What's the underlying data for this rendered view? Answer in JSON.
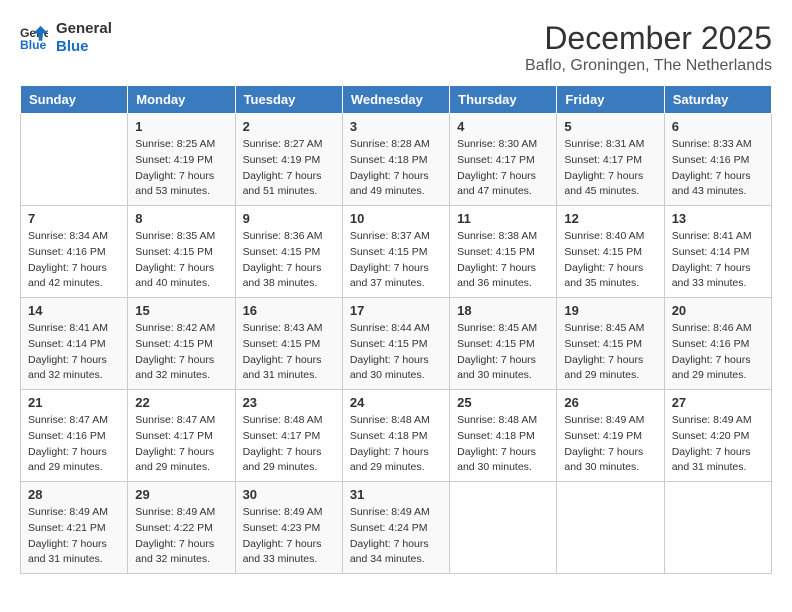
{
  "header": {
    "logo_line1": "General",
    "logo_line2": "Blue",
    "month": "December 2025",
    "location": "Baflo, Groningen, The Netherlands"
  },
  "days_of_week": [
    "Sunday",
    "Monday",
    "Tuesday",
    "Wednesday",
    "Thursday",
    "Friday",
    "Saturday"
  ],
  "weeks": [
    [
      {
        "day": "",
        "sunrise": "",
        "sunset": "",
        "daylight": ""
      },
      {
        "day": "1",
        "sunrise": "Sunrise: 8:25 AM",
        "sunset": "Sunset: 4:19 PM",
        "daylight": "Daylight: 7 hours and 53 minutes."
      },
      {
        "day": "2",
        "sunrise": "Sunrise: 8:27 AM",
        "sunset": "Sunset: 4:19 PM",
        "daylight": "Daylight: 7 hours and 51 minutes."
      },
      {
        "day": "3",
        "sunrise": "Sunrise: 8:28 AM",
        "sunset": "Sunset: 4:18 PM",
        "daylight": "Daylight: 7 hours and 49 minutes."
      },
      {
        "day": "4",
        "sunrise": "Sunrise: 8:30 AM",
        "sunset": "Sunset: 4:17 PM",
        "daylight": "Daylight: 7 hours and 47 minutes."
      },
      {
        "day": "5",
        "sunrise": "Sunrise: 8:31 AM",
        "sunset": "Sunset: 4:17 PM",
        "daylight": "Daylight: 7 hours and 45 minutes."
      },
      {
        "day": "6",
        "sunrise": "Sunrise: 8:33 AM",
        "sunset": "Sunset: 4:16 PM",
        "daylight": "Daylight: 7 hours and 43 minutes."
      }
    ],
    [
      {
        "day": "7",
        "sunrise": "Sunrise: 8:34 AM",
        "sunset": "Sunset: 4:16 PM",
        "daylight": "Daylight: 7 hours and 42 minutes."
      },
      {
        "day": "8",
        "sunrise": "Sunrise: 8:35 AM",
        "sunset": "Sunset: 4:15 PM",
        "daylight": "Daylight: 7 hours and 40 minutes."
      },
      {
        "day": "9",
        "sunrise": "Sunrise: 8:36 AM",
        "sunset": "Sunset: 4:15 PM",
        "daylight": "Daylight: 7 hours and 38 minutes."
      },
      {
        "day": "10",
        "sunrise": "Sunrise: 8:37 AM",
        "sunset": "Sunset: 4:15 PM",
        "daylight": "Daylight: 7 hours and 37 minutes."
      },
      {
        "day": "11",
        "sunrise": "Sunrise: 8:38 AM",
        "sunset": "Sunset: 4:15 PM",
        "daylight": "Daylight: 7 hours and 36 minutes."
      },
      {
        "day": "12",
        "sunrise": "Sunrise: 8:40 AM",
        "sunset": "Sunset: 4:15 PM",
        "daylight": "Daylight: 7 hours and 35 minutes."
      },
      {
        "day": "13",
        "sunrise": "Sunrise: 8:41 AM",
        "sunset": "Sunset: 4:14 PM",
        "daylight": "Daylight: 7 hours and 33 minutes."
      }
    ],
    [
      {
        "day": "14",
        "sunrise": "Sunrise: 8:41 AM",
        "sunset": "Sunset: 4:14 PM",
        "daylight": "Daylight: 7 hours and 32 minutes."
      },
      {
        "day": "15",
        "sunrise": "Sunrise: 8:42 AM",
        "sunset": "Sunset: 4:15 PM",
        "daylight": "Daylight: 7 hours and 32 minutes."
      },
      {
        "day": "16",
        "sunrise": "Sunrise: 8:43 AM",
        "sunset": "Sunset: 4:15 PM",
        "daylight": "Daylight: 7 hours and 31 minutes."
      },
      {
        "day": "17",
        "sunrise": "Sunrise: 8:44 AM",
        "sunset": "Sunset: 4:15 PM",
        "daylight": "Daylight: 7 hours and 30 minutes."
      },
      {
        "day": "18",
        "sunrise": "Sunrise: 8:45 AM",
        "sunset": "Sunset: 4:15 PM",
        "daylight": "Daylight: 7 hours and 30 minutes."
      },
      {
        "day": "19",
        "sunrise": "Sunrise: 8:45 AM",
        "sunset": "Sunset: 4:15 PM",
        "daylight": "Daylight: 7 hours and 29 minutes."
      },
      {
        "day": "20",
        "sunrise": "Sunrise: 8:46 AM",
        "sunset": "Sunset: 4:16 PM",
        "daylight": "Daylight: 7 hours and 29 minutes."
      }
    ],
    [
      {
        "day": "21",
        "sunrise": "Sunrise: 8:47 AM",
        "sunset": "Sunset: 4:16 PM",
        "daylight": "Daylight: 7 hours and 29 minutes."
      },
      {
        "day": "22",
        "sunrise": "Sunrise: 8:47 AM",
        "sunset": "Sunset: 4:17 PM",
        "daylight": "Daylight: 7 hours and 29 minutes."
      },
      {
        "day": "23",
        "sunrise": "Sunrise: 8:48 AM",
        "sunset": "Sunset: 4:17 PM",
        "daylight": "Daylight: 7 hours and 29 minutes."
      },
      {
        "day": "24",
        "sunrise": "Sunrise: 8:48 AM",
        "sunset": "Sunset: 4:18 PM",
        "daylight": "Daylight: 7 hours and 29 minutes."
      },
      {
        "day": "25",
        "sunrise": "Sunrise: 8:48 AM",
        "sunset": "Sunset: 4:18 PM",
        "daylight": "Daylight: 7 hours and 30 minutes."
      },
      {
        "day": "26",
        "sunrise": "Sunrise: 8:49 AM",
        "sunset": "Sunset: 4:19 PM",
        "daylight": "Daylight: 7 hours and 30 minutes."
      },
      {
        "day": "27",
        "sunrise": "Sunrise: 8:49 AM",
        "sunset": "Sunset: 4:20 PM",
        "daylight": "Daylight: 7 hours and 31 minutes."
      }
    ],
    [
      {
        "day": "28",
        "sunrise": "Sunrise: 8:49 AM",
        "sunset": "Sunset: 4:21 PM",
        "daylight": "Daylight: 7 hours and 31 minutes."
      },
      {
        "day": "29",
        "sunrise": "Sunrise: 8:49 AM",
        "sunset": "Sunset: 4:22 PM",
        "daylight": "Daylight: 7 hours and 32 minutes."
      },
      {
        "day": "30",
        "sunrise": "Sunrise: 8:49 AM",
        "sunset": "Sunset: 4:23 PM",
        "daylight": "Daylight: 7 hours and 33 minutes."
      },
      {
        "day": "31",
        "sunrise": "Sunrise: 8:49 AM",
        "sunset": "Sunset: 4:24 PM",
        "daylight": "Daylight: 7 hours and 34 minutes."
      },
      {
        "day": "",
        "sunrise": "",
        "sunset": "",
        "daylight": ""
      },
      {
        "day": "",
        "sunrise": "",
        "sunset": "",
        "daylight": ""
      },
      {
        "day": "",
        "sunrise": "",
        "sunset": "",
        "daylight": ""
      }
    ]
  ]
}
